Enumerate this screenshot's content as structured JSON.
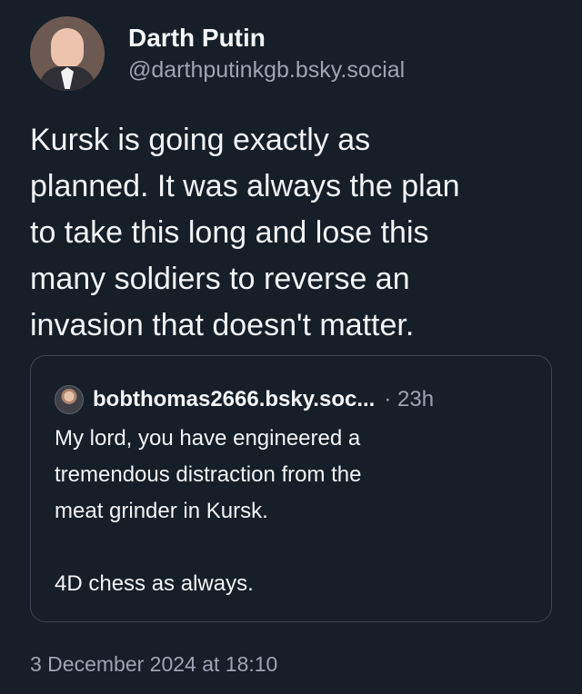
{
  "author": {
    "display_name": "Darth Putin",
    "handle": "@darthputinkgb.bsky.social"
  },
  "post": {
    "text": "Kursk is going exactly as\nplanned. It was always the plan\nto take this long and lose this\nmany soldiers to reverse an\ninvasion that doesn't matter."
  },
  "quoted_post": {
    "handle": "bobthomas2666.bsky.soc...",
    "time": "· 23h",
    "text": "My lord, you have engineered a\ntremendous distraction from the\nmeat grinder in Kursk.\n\n4D chess as always."
  },
  "timestamp": "3 December 2024 at 18:10",
  "colors": {
    "background": "#161e27",
    "primary_text": "#f1f3f5",
    "secondary_text": "#9ba6b3",
    "quote_border": "#3b4654"
  },
  "icons": {
    "author_avatar": "user-avatar-icon",
    "quoted_author_avatar": "user-avatar-icon"
  }
}
